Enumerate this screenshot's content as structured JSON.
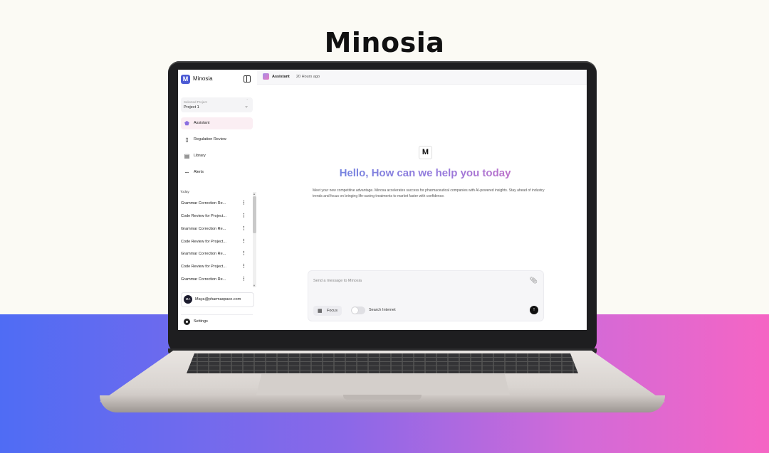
{
  "page": {
    "title": "Minosia"
  },
  "colors": {
    "accent": "#4c5bd4",
    "gradient_start": "#5b8de3",
    "gradient_end": "#ec6bb6"
  },
  "app": {
    "sidebar": {
      "brand": "Minosia",
      "logo_letter": "M",
      "project_select": {
        "caption": "Selected Project",
        "value": "Project 1"
      },
      "nav": [
        {
          "label": "Assistant",
          "icon": "assistant-icon",
          "active": true
        },
        {
          "label": "Regulation Review",
          "icon": "clipboard-icon"
        },
        {
          "label": "Library",
          "icon": "library-icon"
        },
        {
          "label": "Alerts",
          "icon": "rss-icon"
        }
      ],
      "history_heading": "Today",
      "history": [
        "Grammar Correction Re...",
        "Code Review for Project...",
        "Grammar Correction Re...",
        "Code Review for Project...",
        "Grammar Correction Re...",
        "Code Review for Project...",
        "Grammar Correction Re..."
      ],
      "user": {
        "initials": "MA",
        "email": "Maya@pharmaspace.com"
      },
      "settings_label": "Settings"
    },
    "topbar": {
      "title": "Assistant",
      "time": "20 Hours ago"
    },
    "welcome": {
      "logo_letter": "M",
      "heading": "Hello, How can we help you today",
      "description": "Meet your new competitive advantage. Minosa accelerates success for pharmaceutical companies with AI-powered insights. Stay ahead of industry trends and focus on bringing life-saving treatments to market faster with confidence."
    },
    "composer": {
      "placeholder": "Send a message to Minosia",
      "focus_label": "Focus",
      "search_label": "Search Internet"
    }
  }
}
